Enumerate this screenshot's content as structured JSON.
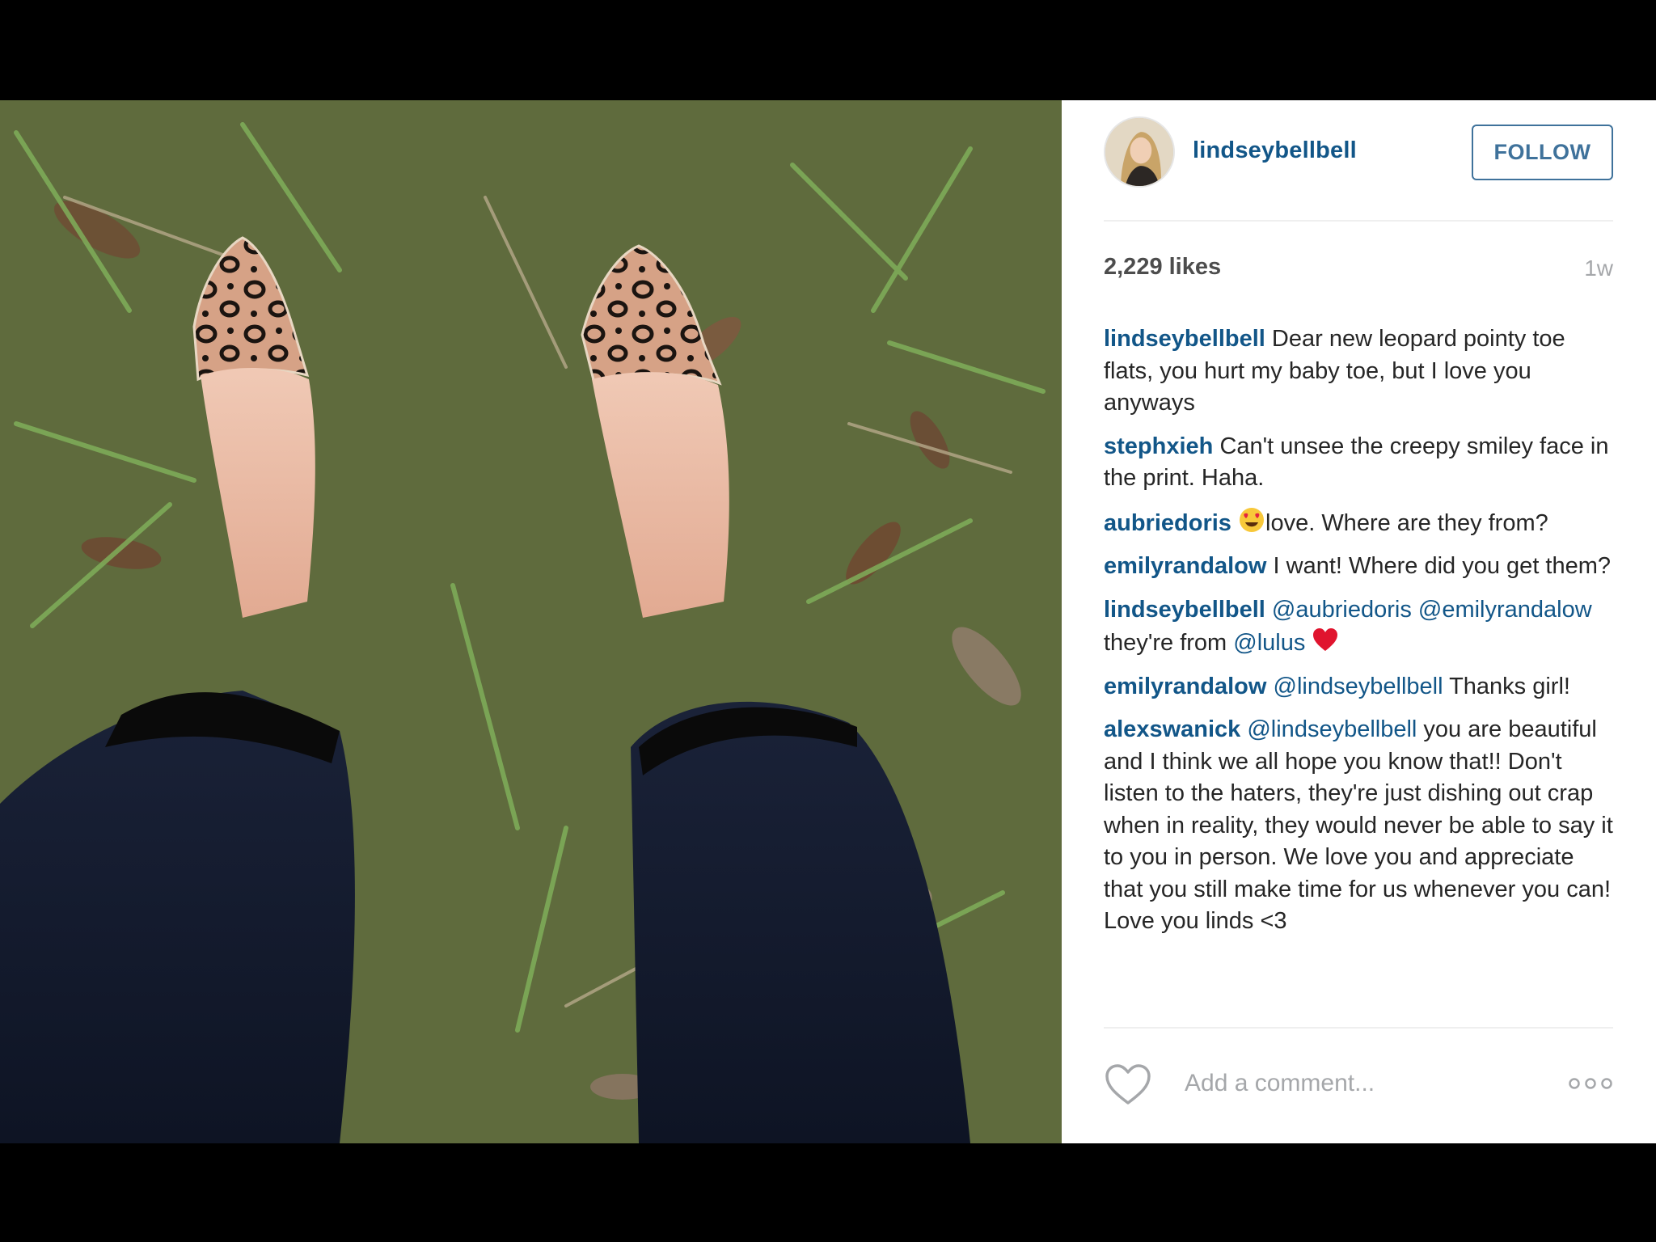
{
  "post": {
    "image_alt": "Feet wearing leopard print pointy toe flats standing on grass",
    "author": {
      "username": "lindseybellbell",
      "follow_label": "FOLLOW"
    },
    "likes_text": "2,229 likes",
    "age_text": "1w",
    "comments": [
      {
        "user": "lindseybellbell",
        "parts": [
          {
            "type": "text",
            "value": "Dear new leopard pointy toe flats, you hurt my baby toe, but I love you anyways"
          }
        ]
      },
      {
        "user": "stephxieh",
        "parts": [
          {
            "type": "text",
            "value": "Can't unsee the creepy smiley face in the print. Haha."
          }
        ]
      },
      {
        "user": "aubriedoris",
        "parts": [
          {
            "type": "emoji",
            "value": "heart-eyes-emoji"
          },
          {
            "type": "text",
            "value": "love. Where are they from?"
          }
        ]
      },
      {
        "user": "emilyrandalow",
        "parts": [
          {
            "type": "text",
            "value": "I want! Where did you get them?"
          }
        ]
      },
      {
        "user": "lindseybellbell",
        "parts": [
          {
            "type": "mention",
            "value": "@aubriedoris"
          },
          {
            "type": "text",
            "value": " "
          },
          {
            "type": "mention",
            "value": "@emilyrandalow"
          },
          {
            "type": "text",
            "value": " they're from "
          },
          {
            "type": "mention",
            "value": "@lulus"
          },
          {
            "type": "text",
            "value": " "
          },
          {
            "type": "emoji",
            "value": "red-heart-emoji"
          }
        ]
      },
      {
        "user": "emilyrandalow",
        "parts": [
          {
            "type": "mention",
            "value": "@lindseybellbell"
          },
          {
            "type": "text",
            "value": " Thanks girl!"
          }
        ]
      },
      {
        "user": "alexswanick",
        "parts": [
          {
            "type": "mention",
            "value": "@lindseybellbell"
          },
          {
            "type": "text",
            "value": " you are beautiful and I think we all hope you know that!! Don't listen to the haters, they're just dishing out crap when in reality, they would never be able to say it to you in person. We love you and appreciate that you still make time for us whenever you can! Love you linds <3"
          }
        ]
      }
    ],
    "comment_placeholder": "Add a comment...",
    "icons": {
      "like": "heart-outline-icon",
      "more": "more-options-icon"
    }
  },
  "colors": {
    "username_blue": "#125688",
    "follow_blue": "#3f729b",
    "muted_gray": "#a5a7aa",
    "text_dark": "#262626"
  }
}
